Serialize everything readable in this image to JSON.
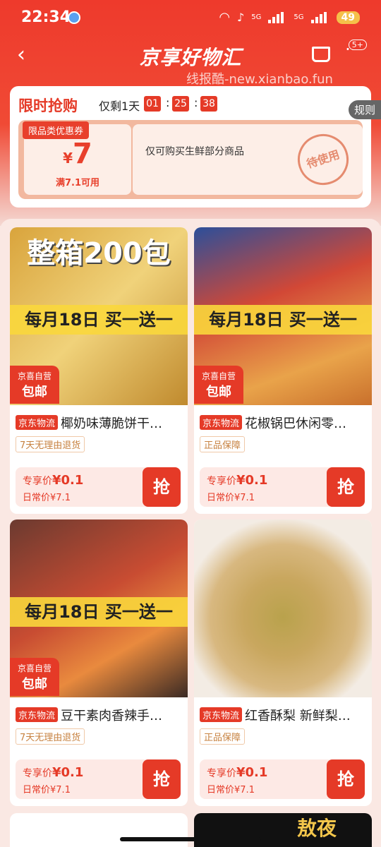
{
  "status": {
    "time": "22:34",
    "signal1": "5G",
    "signal2": "5G",
    "battery": "49"
  },
  "nav": {
    "title": "京享好物汇",
    "badge": "5+"
  },
  "watermark": "线报酷-new.xianbao.fun",
  "flash": {
    "title": "限时抢购",
    "remain": "仅剩1天",
    "h": "01",
    "m": "25",
    "s": "38",
    "rules": "规则",
    "coupon": {
      "tag": "限品类优惠券",
      "currency": "¥",
      "amount": "7",
      "condition": "满7.1可用",
      "desc": "仅可购买生鲜部分商品",
      "stamp": "待使用"
    }
  },
  "products": [
    {
      "headline": "整箱200包",
      "banner": "每月18日 买一送一",
      "free1": "京喜自营",
      "free2": "包邮",
      "tag": "京东物流",
      "name": "椰奶味薄脆饼干…",
      "service": "7天无理由退货",
      "price_label": "专享价",
      "price": "¥0.1",
      "normal_label": "日常价",
      "normal": "¥7.1",
      "grab": "抢"
    },
    {
      "headline": "",
      "banner": "每月18日 买一送一",
      "free1": "京喜自营",
      "free2": "包邮",
      "tag": "京东物流",
      "name": "花椒锅巴休闲零…",
      "service": "正品保障",
      "price_label": "专享价",
      "price": "¥0.1",
      "normal_label": "日常价",
      "normal": "¥7.1",
      "grab": "抢"
    },
    {
      "headline": "",
      "banner": "每月18日 买一送一",
      "free1": "京喜自营",
      "free2": "包邮",
      "tag": "京东物流",
      "name": "豆干素肉香辣手…",
      "service": "7天无理由退货",
      "price_label": "专享价",
      "price": "¥0.1",
      "normal_label": "日常价",
      "normal": "¥7.1",
      "grab": "抢"
    },
    {
      "headline": "",
      "banner": "",
      "free1": "",
      "free2": "",
      "tag": "京东物流",
      "name": "红香酥梨 新鲜梨…",
      "service": "正品保障",
      "price_label": "专享价",
      "price": "¥0.1",
      "normal_label": "日常价",
      "normal": "¥7.1",
      "grab": "抢"
    }
  ],
  "bottom_peek": "敖夜"
}
